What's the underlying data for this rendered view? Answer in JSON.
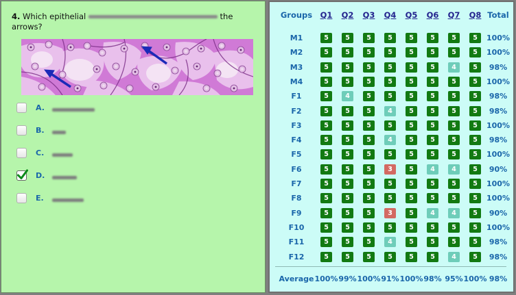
{
  "question": {
    "number": "4.",
    "text_start": "Which epithelial",
    "text_end": "the",
    "text_line2": "arrows?"
  },
  "choices": [
    {
      "label": "A.",
      "checked": false
    },
    {
      "label": "B.",
      "checked": false
    },
    {
      "label": "C.",
      "checked": false
    },
    {
      "label": "D.",
      "checked": true
    },
    {
      "label": "E.",
      "checked": false
    }
  ],
  "table": {
    "headers": [
      "Groups",
      "Q1",
      "Q2",
      "Q3",
      "Q4",
      "Q5",
      "Q6",
      "Q7",
      "Q8",
      "Total"
    ],
    "rows": [
      {
        "group": "M1",
        "scores": [
          5,
          5,
          5,
          5,
          5,
          5,
          5,
          5
        ],
        "total": "100%"
      },
      {
        "group": "M2",
        "scores": [
          5,
          5,
          5,
          5,
          5,
          5,
          5,
          5
        ],
        "total": "100%"
      },
      {
        "group": "M3",
        "scores": [
          5,
          5,
          5,
          5,
          5,
          5,
          4,
          5
        ],
        "total": "98%"
      },
      {
        "group": "M4",
        "scores": [
          5,
          5,
          5,
          5,
          5,
          5,
          5,
          5
        ],
        "total": "100%"
      },
      {
        "group": "F1",
        "scores": [
          5,
          4,
          5,
          5,
          5,
          5,
          5,
          5
        ],
        "total": "98%"
      },
      {
        "group": "F2",
        "scores": [
          5,
          5,
          5,
          4,
          5,
          5,
          5,
          5
        ],
        "total": "98%"
      },
      {
        "group": "F3",
        "scores": [
          5,
          5,
          5,
          5,
          5,
          5,
          5,
          5
        ],
        "total": "100%"
      },
      {
        "group": "F4",
        "scores": [
          5,
          5,
          5,
          4,
          5,
          5,
          5,
          5
        ],
        "total": "98%"
      },
      {
        "group": "F5",
        "scores": [
          5,
          5,
          5,
          5,
          5,
          5,
          5,
          5
        ],
        "total": "100%"
      },
      {
        "group": "F6",
        "scores": [
          5,
          5,
          5,
          3,
          5,
          4,
          4,
          5
        ],
        "total": "90%"
      },
      {
        "group": "F7",
        "scores": [
          5,
          5,
          5,
          5,
          5,
          5,
          5,
          5
        ],
        "total": "100%"
      },
      {
        "group": "F8",
        "scores": [
          5,
          5,
          5,
          5,
          5,
          5,
          5,
          5
        ],
        "total": "100%"
      },
      {
        "group": "F9",
        "scores": [
          5,
          5,
          5,
          3,
          5,
          4,
          4,
          5
        ],
        "total": "90%"
      },
      {
        "group": "F10",
        "scores": [
          5,
          5,
          5,
          5,
          5,
          5,
          5,
          5
        ],
        "total": "100%"
      },
      {
        "group": "F11",
        "scores": [
          5,
          5,
          5,
          4,
          5,
          5,
          5,
          5
        ],
        "total": "98%"
      },
      {
        "group": "F12",
        "scores": [
          5,
          5,
          5,
          5,
          5,
          5,
          4,
          5
        ],
        "total": "98%"
      }
    ],
    "average": {
      "label": "Average",
      "values": [
        "100%",
        "99%",
        "100%",
        "91%",
        "100%",
        "98%",
        "95%",
        "100%",
        "98%"
      ]
    }
  },
  "colors": {
    "score_5": "#127a12",
    "score_4": "#6ecdb9",
    "score_3": "#d36a62"
  }
}
